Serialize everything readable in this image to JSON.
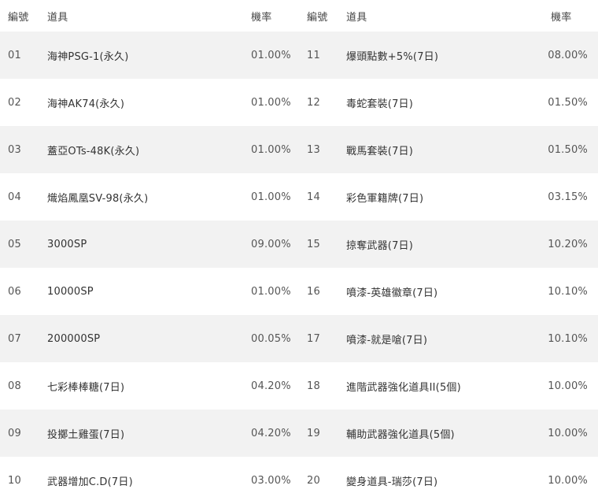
{
  "header": {
    "no": "編號",
    "item": "道具",
    "rate": "機率"
  },
  "rows": [
    {
      "no1": "01",
      "item1": "海神PSG-1(永久)",
      "rate1": "01.00%",
      "no2": "11",
      "item2": "爆頭點數+5%(7日)",
      "rate2": "08.00%"
    },
    {
      "no1": "02",
      "item1": "海神AK74(永久)",
      "rate1": "01.00%",
      "no2": "12",
      "item2": "毒蛇套裝(7日)",
      "rate2": "01.50%"
    },
    {
      "no1": "03",
      "item1": "蓋亞OTs-48K(永久)",
      "rate1": "01.00%",
      "no2": "13",
      "item2": "戰馬套裝(7日)",
      "rate2": "01.50%"
    },
    {
      "no1": "04",
      "item1": "熾焰鳳凰SV-98(永久)",
      "rate1": "01.00%",
      "no2": "14",
      "item2": "彩色軍籍牌(7日)",
      "rate2": "03.15%"
    },
    {
      "no1": "05",
      "item1": "3000SP",
      "rate1": "09.00%",
      "no2": "15",
      "item2": "掠奪武器(7日)",
      "rate2": "10.20%"
    },
    {
      "no1": "06",
      "item1": "10000SP",
      "rate1": "01.00%",
      "no2": "16",
      "item2": "噴漆-英雄徽章(7日)",
      "rate2": "10.10%"
    },
    {
      "no1": "07",
      "item1": "200000SP",
      "rate1": "00.05%",
      "no2": "17",
      "item2": "噴漆-就是嗆(7日)",
      "rate2": "10.10%"
    },
    {
      "no1": "08",
      "item1": "七彩棒棒糖(7日)",
      "rate1": "04.20%",
      "no2": "18",
      "item2": "進階武器強化道具II(5個)",
      "rate2": "10.00%"
    },
    {
      "no1": "09",
      "item1": "投擲土雞蛋(7日)",
      "rate1": "04.20%",
      "no2": "19",
      "item2": "輔助武器強化道具(5個)",
      "rate2": "10.00%"
    },
    {
      "no1": "10",
      "item1": "武器增加C.D(7日)",
      "rate1": "03.00%",
      "no2": "20",
      "item2": "變身道具-瑞莎(7日)",
      "rate2": "10.00%"
    }
  ]
}
